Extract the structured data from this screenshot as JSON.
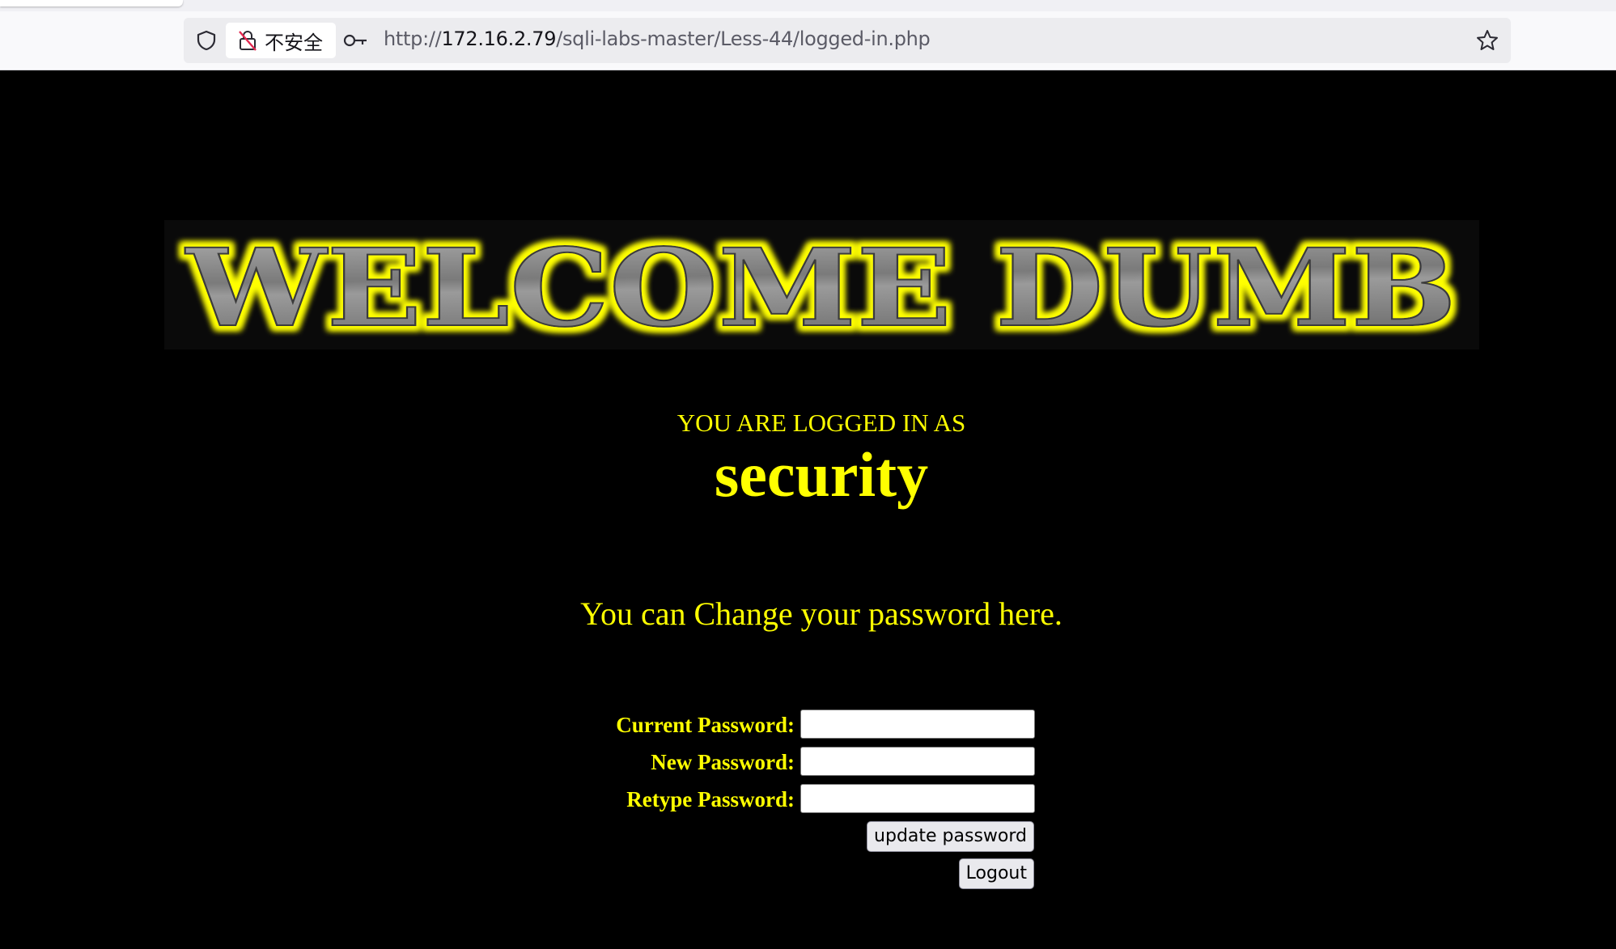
{
  "browser": {
    "security_label": "不安全",
    "url_scheme": "http://",
    "url_host": "172.16.2.79",
    "url_path": "/sqli-labs-master/Less-44/logged-in.php"
  },
  "page": {
    "banner_text": "WELCOME DUMB",
    "logged_in_label": "YOU ARE LOGGED IN AS",
    "username": "security",
    "change_message": "You can Change your password here.",
    "form": {
      "current_password_label": "Current Password:",
      "new_password_label": "New Password:",
      "retype_password_label": "Retype Password:",
      "current_password_value": "",
      "new_password_value": "",
      "retype_password_value": "",
      "update_button": "update password",
      "logout_button": "Logout"
    }
  },
  "colors": {
    "page_background": "#000000",
    "text_accent": "#ffff00",
    "banner_glow": "#ffff00",
    "banner_fill": "#8c8c8c"
  },
  "icons": [
    "shield-icon",
    "insecure-lock-icon",
    "key-icon",
    "bookmark-star-icon"
  ]
}
